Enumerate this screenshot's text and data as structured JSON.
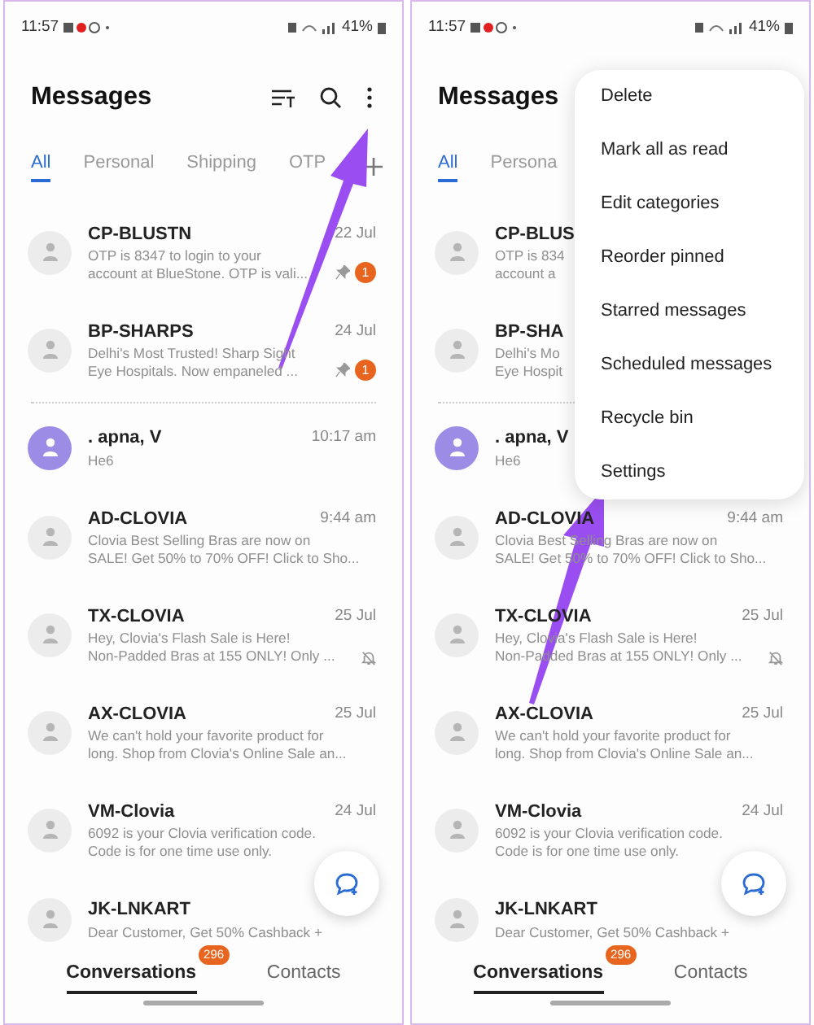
{
  "screens": [
    {
      "kind": "list",
      "status_bar": {
        "time": "11:57",
        "battery": "41%"
      },
      "title": "Messages",
      "tabs": [
        {
          "label": "All",
          "selected": true
        },
        {
          "label": "Personal",
          "selected": false
        },
        {
          "label": "Shipping",
          "selected": false
        },
        {
          "label": "OTP",
          "selected": false
        }
      ],
      "pinned_conversations": [
        {
          "name": "CP-BLUSTN",
          "time": "22 Jul",
          "lines": [
            "OTP is 8347 to login to your",
            "account at BlueStone. OTP is vali..."
          ],
          "pinned": true,
          "unread": "1",
          "color": "#ececec"
        },
        {
          "name": "BP-SHARPS",
          "time": "24 Jul",
          "lines": [
            "Delhi's Most Trusted! Sharp Sight",
            "Eye Hospitals. Now empaneled ..."
          ],
          "pinned": true,
          "unread": "1",
          "color": "#ececec"
        }
      ],
      "conversations": [
        {
          "name": ". apna, V",
          "time": "10:17 am",
          "lines": [
            "He6"
          ],
          "color": "#9c8ce6"
        },
        {
          "name": "AD-CLOVIA",
          "time": "9:44 am",
          "lines": [
            "Clovia Best Selling Bras are now on",
            "SALE! Get 50% to 70% OFF! Click to Sho..."
          ],
          "color": "#ececec"
        },
        {
          "name": "TX-CLOVIA",
          "time": "25 Jul",
          "lines": [
            "Hey, Clovia's Flash Sale is Here!",
            "Non-Padded Bras at 155 ONLY! Only ..."
          ],
          "muted": true,
          "color": "#ececec"
        },
        {
          "name": "AX-CLOVIA",
          "time": "25 Jul",
          "lines": [
            "We can't hold your favorite product for",
            "long. Shop from Clovia's Online Sale an..."
          ],
          "color": "#ececec"
        },
        {
          "name": "VM-Clovia",
          "time": "24 Jul",
          "lines": [
            "6092 is your Clovia verification code.",
            "Code is for one time use only."
          ],
          "color": "#ececec"
        },
        {
          "name": "JK-LNKART",
          "lines": [
            "Dear Customer, Get 50% Cashback +"
          ],
          "color": "#ececec"
        }
      ],
      "nav": [
        {
          "label": "Conversations",
          "selected": true,
          "badge": "296"
        },
        {
          "label": "Contacts",
          "selected": false
        }
      ]
    },
    {
      "kind": "menu_open",
      "status_bar": {
        "time": "11:57",
        "battery": "41%"
      },
      "title": "Messages",
      "tabs": [
        {
          "label": "All",
          "selected": true
        },
        {
          "label": "Persona",
          "selected": false
        }
      ],
      "pinned_conversations": [
        {
          "name": "CP-BLUS",
          "lines": [
            "OTP is 834",
            "account a"
          ],
          "color": "#ececec"
        },
        {
          "name": "BP-SHA",
          "lines": [
            "Delhi's Mo",
            "Eye Hospit"
          ],
          "color": "#ececec"
        }
      ],
      "conversations": [
        {
          "name": ". apna, V",
          "lines": [
            "He6"
          ],
          "color": "#9c8ce6"
        },
        {
          "name": "AD-CLOVIA",
          "time": "9:44 am",
          "lines": [
            "Clovia Best Selling Bras are now on",
            "SALE! Get 50% to 70% OFF! Click to Sho..."
          ],
          "color": "#ececec"
        },
        {
          "name": "TX-CLOVIA",
          "time": "25 Jul",
          "lines": [
            "Hey, Clovia's Flash Sale is Here!",
            "Non-Padded Bras at 155 ONLY! Only ..."
          ],
          "muted": true,
          "color": "#ececec"
        },
        {
          "name": "AX-CLOVIA",
          "time": "25 Jul",
          "lines": [
            "We can't hold your favorite product for",
            "long. Shop from Clovia's Online Sale an..."
          ],
          "color": "#ececec"
        },
        {
          "name": "VM-Clovia",
          "time": "24 Jul",
          "lines": [
            "6092 is your Clovia verification code.",
            "Code is for one time use only."
          ],
          "color": "#ececec"
        },
        {
          "name": "JK-LNKART",
          "lines": [
            "Dear Customer, Get 50% Cashback +"
          ],
          "color": "#ececec"
        }
      ],
      "nav": [
        {
          "label": "Conversations",
          "selected": true,
          "badge": "296"
        },
        {
          "label": "Contacts",
          "selected": false
        }
      ],
      "menu": [
        "Delete",
        "Mark all as read",
        "Edit categories",
        "Reorder pinned",
        "Starred messages",
        "Scheduled messages",
        "Recycle bin",
        "Settings"
      ]
    }
  ]
}
